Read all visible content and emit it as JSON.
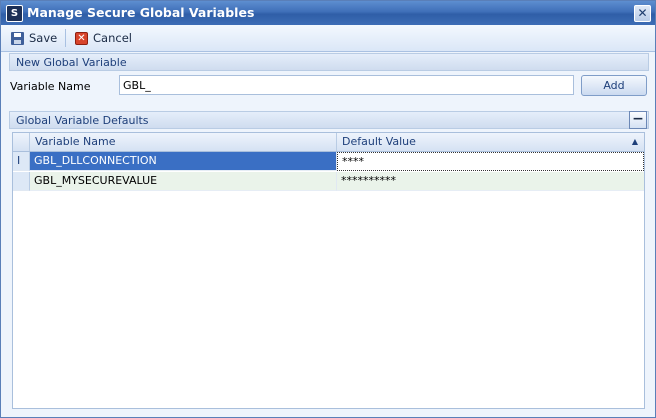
{
  "window": {
    "title": "Manage Secure Global Variables",
    "app_icon": "S"
  },
  "toolbar": {
    "save_label": "Save",
    "cancel_label": "Cancel"
  },
  "new_variable": {
    "section_title": "New Global Variable",
    "field_label": "Variable Name",
    "field_value": "GBL_",
    "add_label": "Add"
  },
  "defaults": {
    "section_title": "Global Variable Defaults",
    "collapse_symbol": "−",
    "columns": [
      "Variable Name",
      "Default Value"
    ],
    "rows": [
      {
        "name": "GBL_DLLCONNECTION",
        "value": "****"
      },
      {
        "name": "GBL_MYSECUREVALUE",
        "value": "**********"
      }
    ]
  },
  "icons": {
    "app": "app-logo-icon",
    "close": "close-icon",
    "save": "floppy-disk-icon",
    "cancel": "red-x-icon",
    "sort": "sort-ascending-icon",
    "row_edit": "text-cursor-icon"
  },
  "colors": {
    "titlebar": "#3f6fb8",
    "selection": "#3a6fc4",
    "alt_row": "#eaf3ea"
  }
}
